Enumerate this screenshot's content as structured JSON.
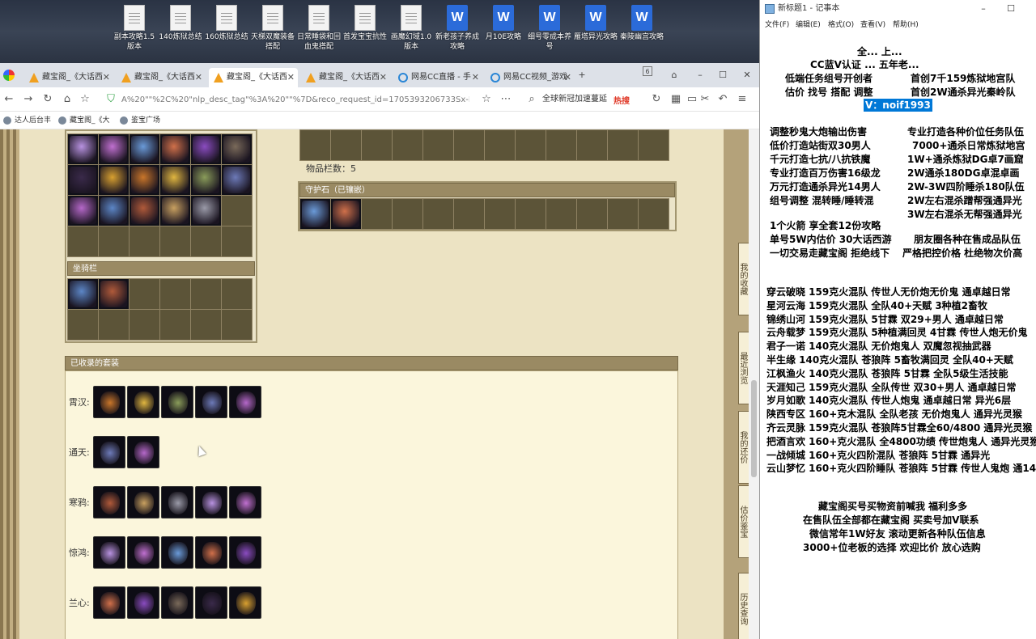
{
  "desktop": {
    "icons": [
      {
        "label": "副本攻略1.5版本",
        "type": "file"
      },
      {
        "label": "140炼狱总结",
        "type": "file"
      },
      {
        "label": "160炼狱总结",
        "type": "file"
      },
      {
        "label": "天梯双魔装备搭配",
        "type": "file"
      },
      {
        "label": "日常睡袋和回血鬼搭配",
        "type": "file"
      },
      {
        "label": "首发宝宝抗性",
        "type": "file"
      },
      {
        "label": "画魔幻域1.0版本",
        "type": "file"
      },
      {
        "label": "新老孩子养成攻略",
        "type": "word"
      },
      {
        "label": "月10E攻略",
        "type": "word"
      },
      {
        "label": "细号零成本养号",
        "type": "word"
      },
      {
        "label": "雁塔异光攻略",
        "type": "word"
      },
      {
        "label": "秦陵幽宫攻略",
        "type": "word"
      }
    ]
  },
  "browser": {
    "tabs": [
      {
        "label": "藏宝阁_《大话西",
        "icon": "treasure-icon",
        "active": false
      },
      {
        "label": "藏宝阁_《大话西",
        "icon": "treasure-icon",
        "active": false
      },
      {
        "label": "藏宝阁_《大话西",
        "icon": "treasure-icon",
        "active": true
      },
      {
        "label": "藏宝阁_《大话西",
        "icon": "treasure-icon",
        "active": false
      },
      {
        "label": "网易CC直播 - 手",
        "icon": "cc-icon",
        "active": false
      },
      {
        "label": "网易CC视频_游戏",
        "icon": "cc-icon",
        "active": false
      }
    ],
    "tab_count_badge": "6",
    "url": "A%20\"\"%2C%20\"nlp_desc_tag\"%3A%20\"\"%7D&reco_request_id=1705393206733Sx-MF",
    "search_placeholder": "全球新冠加速蔓延",
    "search_hot": "热搜",
    "bookmarks": [
      "达人后台丰",
      "藏宝阁_《大",
      "鉴宝广场"
    ]
  },
  "page": {
    "items_count_label": "物品栏数：5",
    "guard_stone_label": "守护石（已镶嵌）",
    "stable_label": "坐骑栏",
    "suits_header": "已收录的套装",
    "suits": [
      {
        "name": "霄汉:",
        "count": 5
      },
      {
        "name": "通天:",
        "count": 2
      },
      {
        "name": "寒鸦:",
        "count": 5
      },
      {
        "name": "惊鸿:",
        "count": 5
      },
      {
        "name": "兰心:",
        "count": 5
      }
    ],
    "side_tabs": [
      "我的收藏",
      "最近浏览",
      "我的还价",
      "估价鉴宝",
      "历史查询"
    ]
  },
  "notepad": {
    "title": "新标题1 - 记事本",
    "menu": [
      "文件(F)",
      "编辑(E)",
      "格式(O)",
      "查看(V)",
      "帮助(H)"
    ],
    "lines_top": [
      "全...[?]...上... (partially obscured)",
      "CC蓝V认证 ... 五年老...",
      "低端任务组号开创者",
      "首创7千159炼狱地宫队",
      "估价 找号 搭配 调整",
      "首创2W通杀异光秦岭队",
      "V：noif1993"
    ],
    "services_left": [
      "调整秒鬼大炮输出伤害",
      "低价打造站街双30男人",
      "千元打造七抗/八抗铁魔",
      "专业打造百万伤害16级龙",
      "万元打造通杀异光14男人",
      "组号调整 混转睡/睡转混"
    ],
    "services_right": [
      "专业打造各种价位任务队伍",
      "7000+通杀日常炼狱地宫",
      "1W+通杀炼狱DG卓7画窟",
      "2W通杀180DG卓混卓画",
      "2W-3W四阶睡杀180队伍",
      "2W左右混杀蹭帮强通异光",
      "3W左右混杀无帮强通异光"
    ],
    "line_a": "1个火箭 享全套12份攻略",
    "line_b_left": "单号5W内估价 30大话西游",
    "line_b_right": "朋友圈各种在售成品队伍",
    "line_c_left": "一切交易走藏宝阁 拒绝线下",
    "line_c_right": "严格把控价格 杜绝物次价高",
    "teams": [
      "穿云破晓 159克火混队 传世人无价炮无价鬼 通卓越日常",
      "星河云海 159克火混队 全队40+天赋 3种植2畜牧",
      "锦绣山河 159克火混队 5甘霖 双29+男人 通卓越日常",
      "云舟载梦 159克火混队 5种植满回灵 4甘霖 传世人炮无价鬼",
      "君子一诺 140克火混队 无价炮鬼人 双魔忽视抽武器",
      "半生缘    140克火混队 苍狼阵 5畜牧满回灵 全队40+天赋",
      "江枫渔火 140克火混队 苍狼阵 5甘霖 全队5级生活技能",
      "天涯知己 159克火混队 全队传世 双30+男人 通卓越日常",
      "岁月如歌 140克火混队 传世人炮鬼 通卓越日常 异光6层",
      "陕西专区 160+克木混队 全队老孩 无价炮鬼人 通异光灵猴",
      "齐云灵脉 159克火混队 苍狼阵5甘霖全60/4800 通异光灵猴",
      "把酒言欢 160+克火混队 全4800功绩 传世炮鬼人 通异光灵猴",
      "一战倾城 160+克火四阶混队 苍狼阵 5甘霖 通异光",
      "云山梦忆 160+克火四阶睡队 苍狼阵 5甘霖 传世人鬼炮 通14"
    ],
    "footer": [
      "藏宝阁买号买物资前喊我 福利多多",
      "在售队伍全部都在藏宝阁 买卖号加V联系",
      "微信常年1W好友 滚动更新各种队伍信息",
      "3000+位老板的选择 欢迎比价 放心选购"
    ]
  },
  "colors": {
    "page_bg": "#ece3c3",
    "slot_bg": "#5c5438",
    "header_bg": "#9a8a63",
    "selection": "#0078d7"
  }
}
